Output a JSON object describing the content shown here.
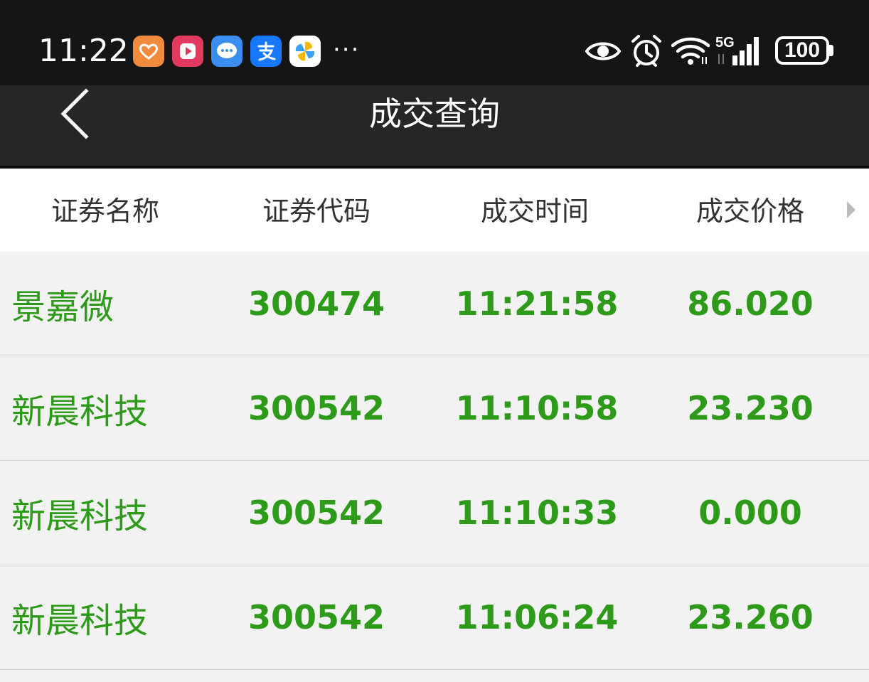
{
  "status_bar": {
    "time": "11:22",
    "app_icons": [
      {
        "name": "heart-app-icon",
        "color": "#f08a3c"
      },
      {
        "name": "video-app-icon",
        "color": "#e23a5e"
      },
      {
        "name": "message-app-icon",
        "color": "#3a8ef0"
      },
      {
        "name": "alipay-icon",
        "color": "#1677ff"
      },
      {
        "name": "pinwheel-app-icon",
        "color": "#ffffff"
      }
    ],
    "more": "···",
    "network": "5G",
    "battery": "100"
  },
  "nav": {
    "title": "成交查询"
  },
  "table": {
    "headers": [
      "证券名称",
      "证券代码",
      "成交时间",
      "成交价格"
    ],
    "rows": [
      {
        "name": "景嘉微",
        "code": "300474",
        "time": "11:21:58",
        "price": "86.020"
      },
      {
        "name": "新晨科技",
        "code": "300542",
        "time": "11:10:58",
        "price": "23.230"
      },
      {
        "name": "新晨科技",
        "code": "300542",
        "time": "11:10:33",
        "price": "0.000"
      },
      {
        "name": "新晨科技",
        "code": "300542",
        "time": "11:06:24",
        "price": "23.260"
      }
    ]
  },
  "colors": {
    "accent_green": "#2e9a1a",
    "status_bar_bg": "#151515",
    "nav_bg": "#262626"
  }
}
